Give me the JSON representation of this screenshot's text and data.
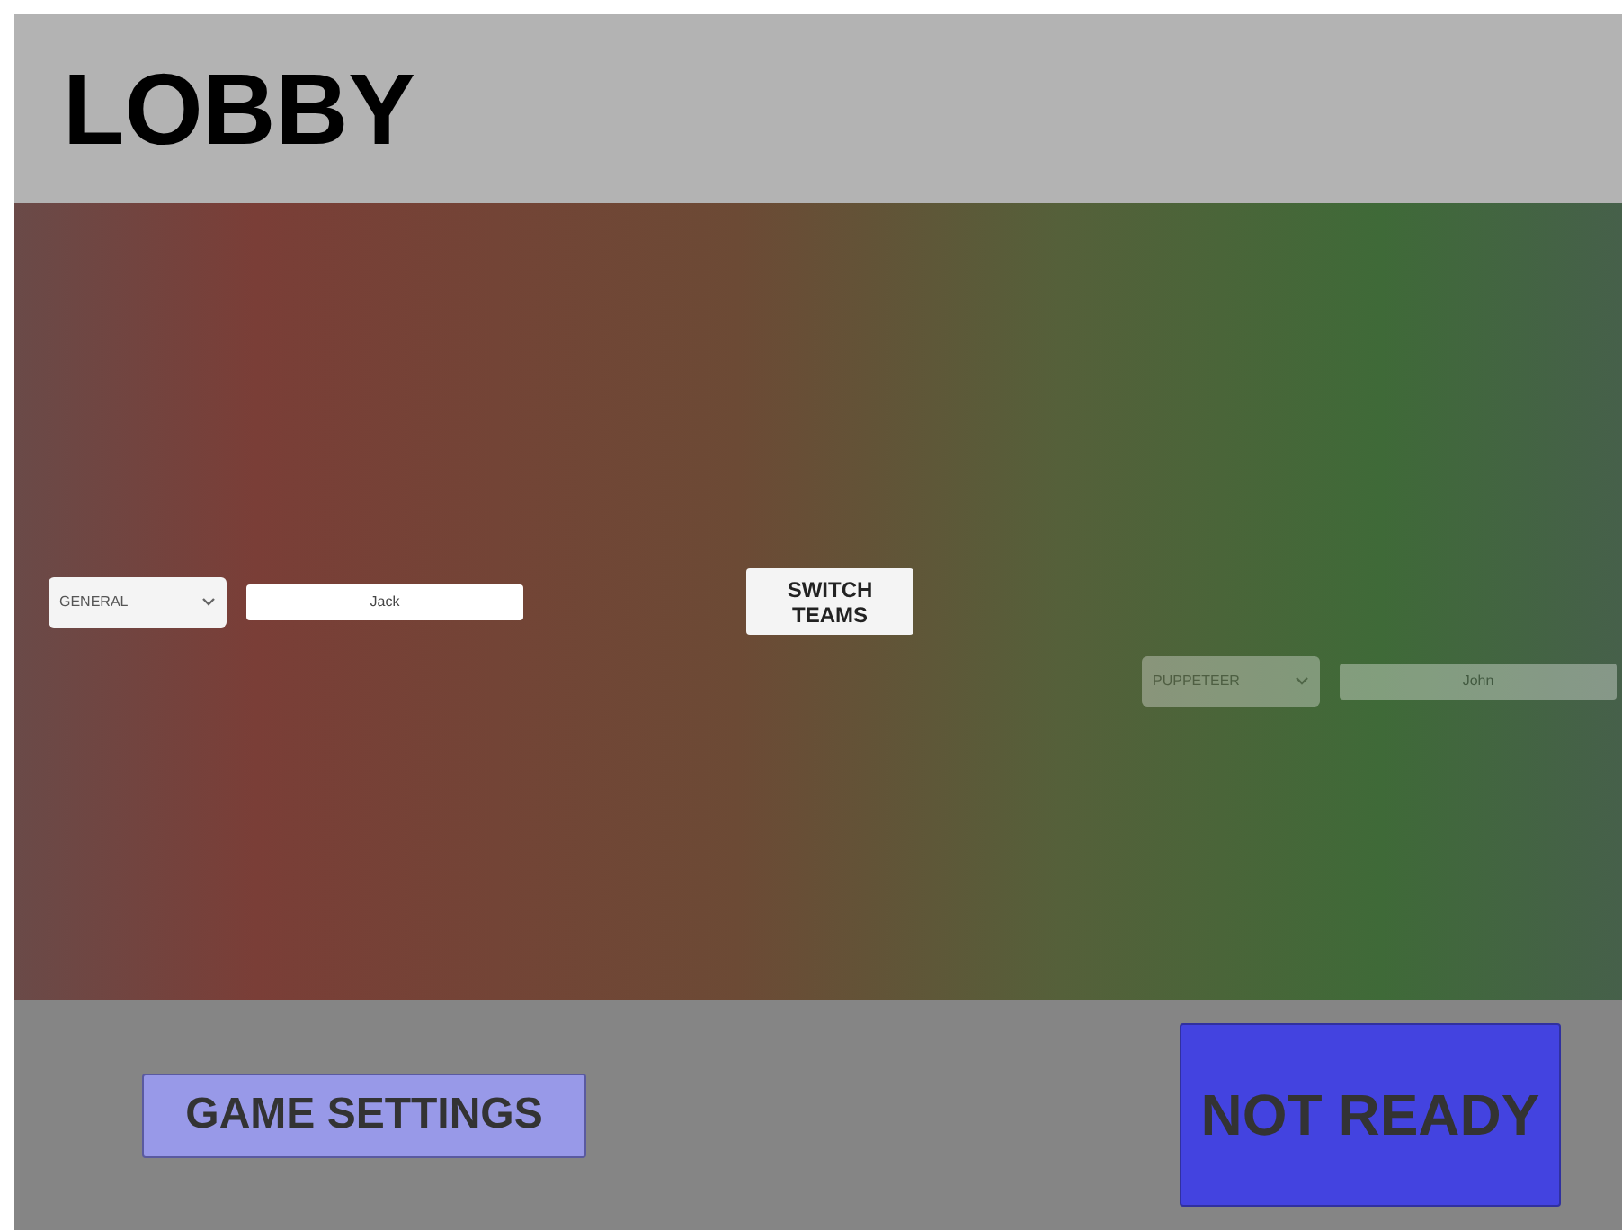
{
  "header": {
    "title": "LOBBY"
  },
  "players": [
    {
      "kind": "left",
      "role": "GENERAL",
      "name": "Jack",
      "disabled": false
    },
    {
      "kind": "right",
      "role": "PUPPETEER",
      "name": "John",
      "disabled": true
    }
  ],
  "switch_button": {
    "label": "SWITCH TEAMS"
  },
  "footer": {
    "settings_button": "GAME SETTINGS",
    "ready_button": {
      "label": "NOT READY",
      "ready": false
    }
  }
}
